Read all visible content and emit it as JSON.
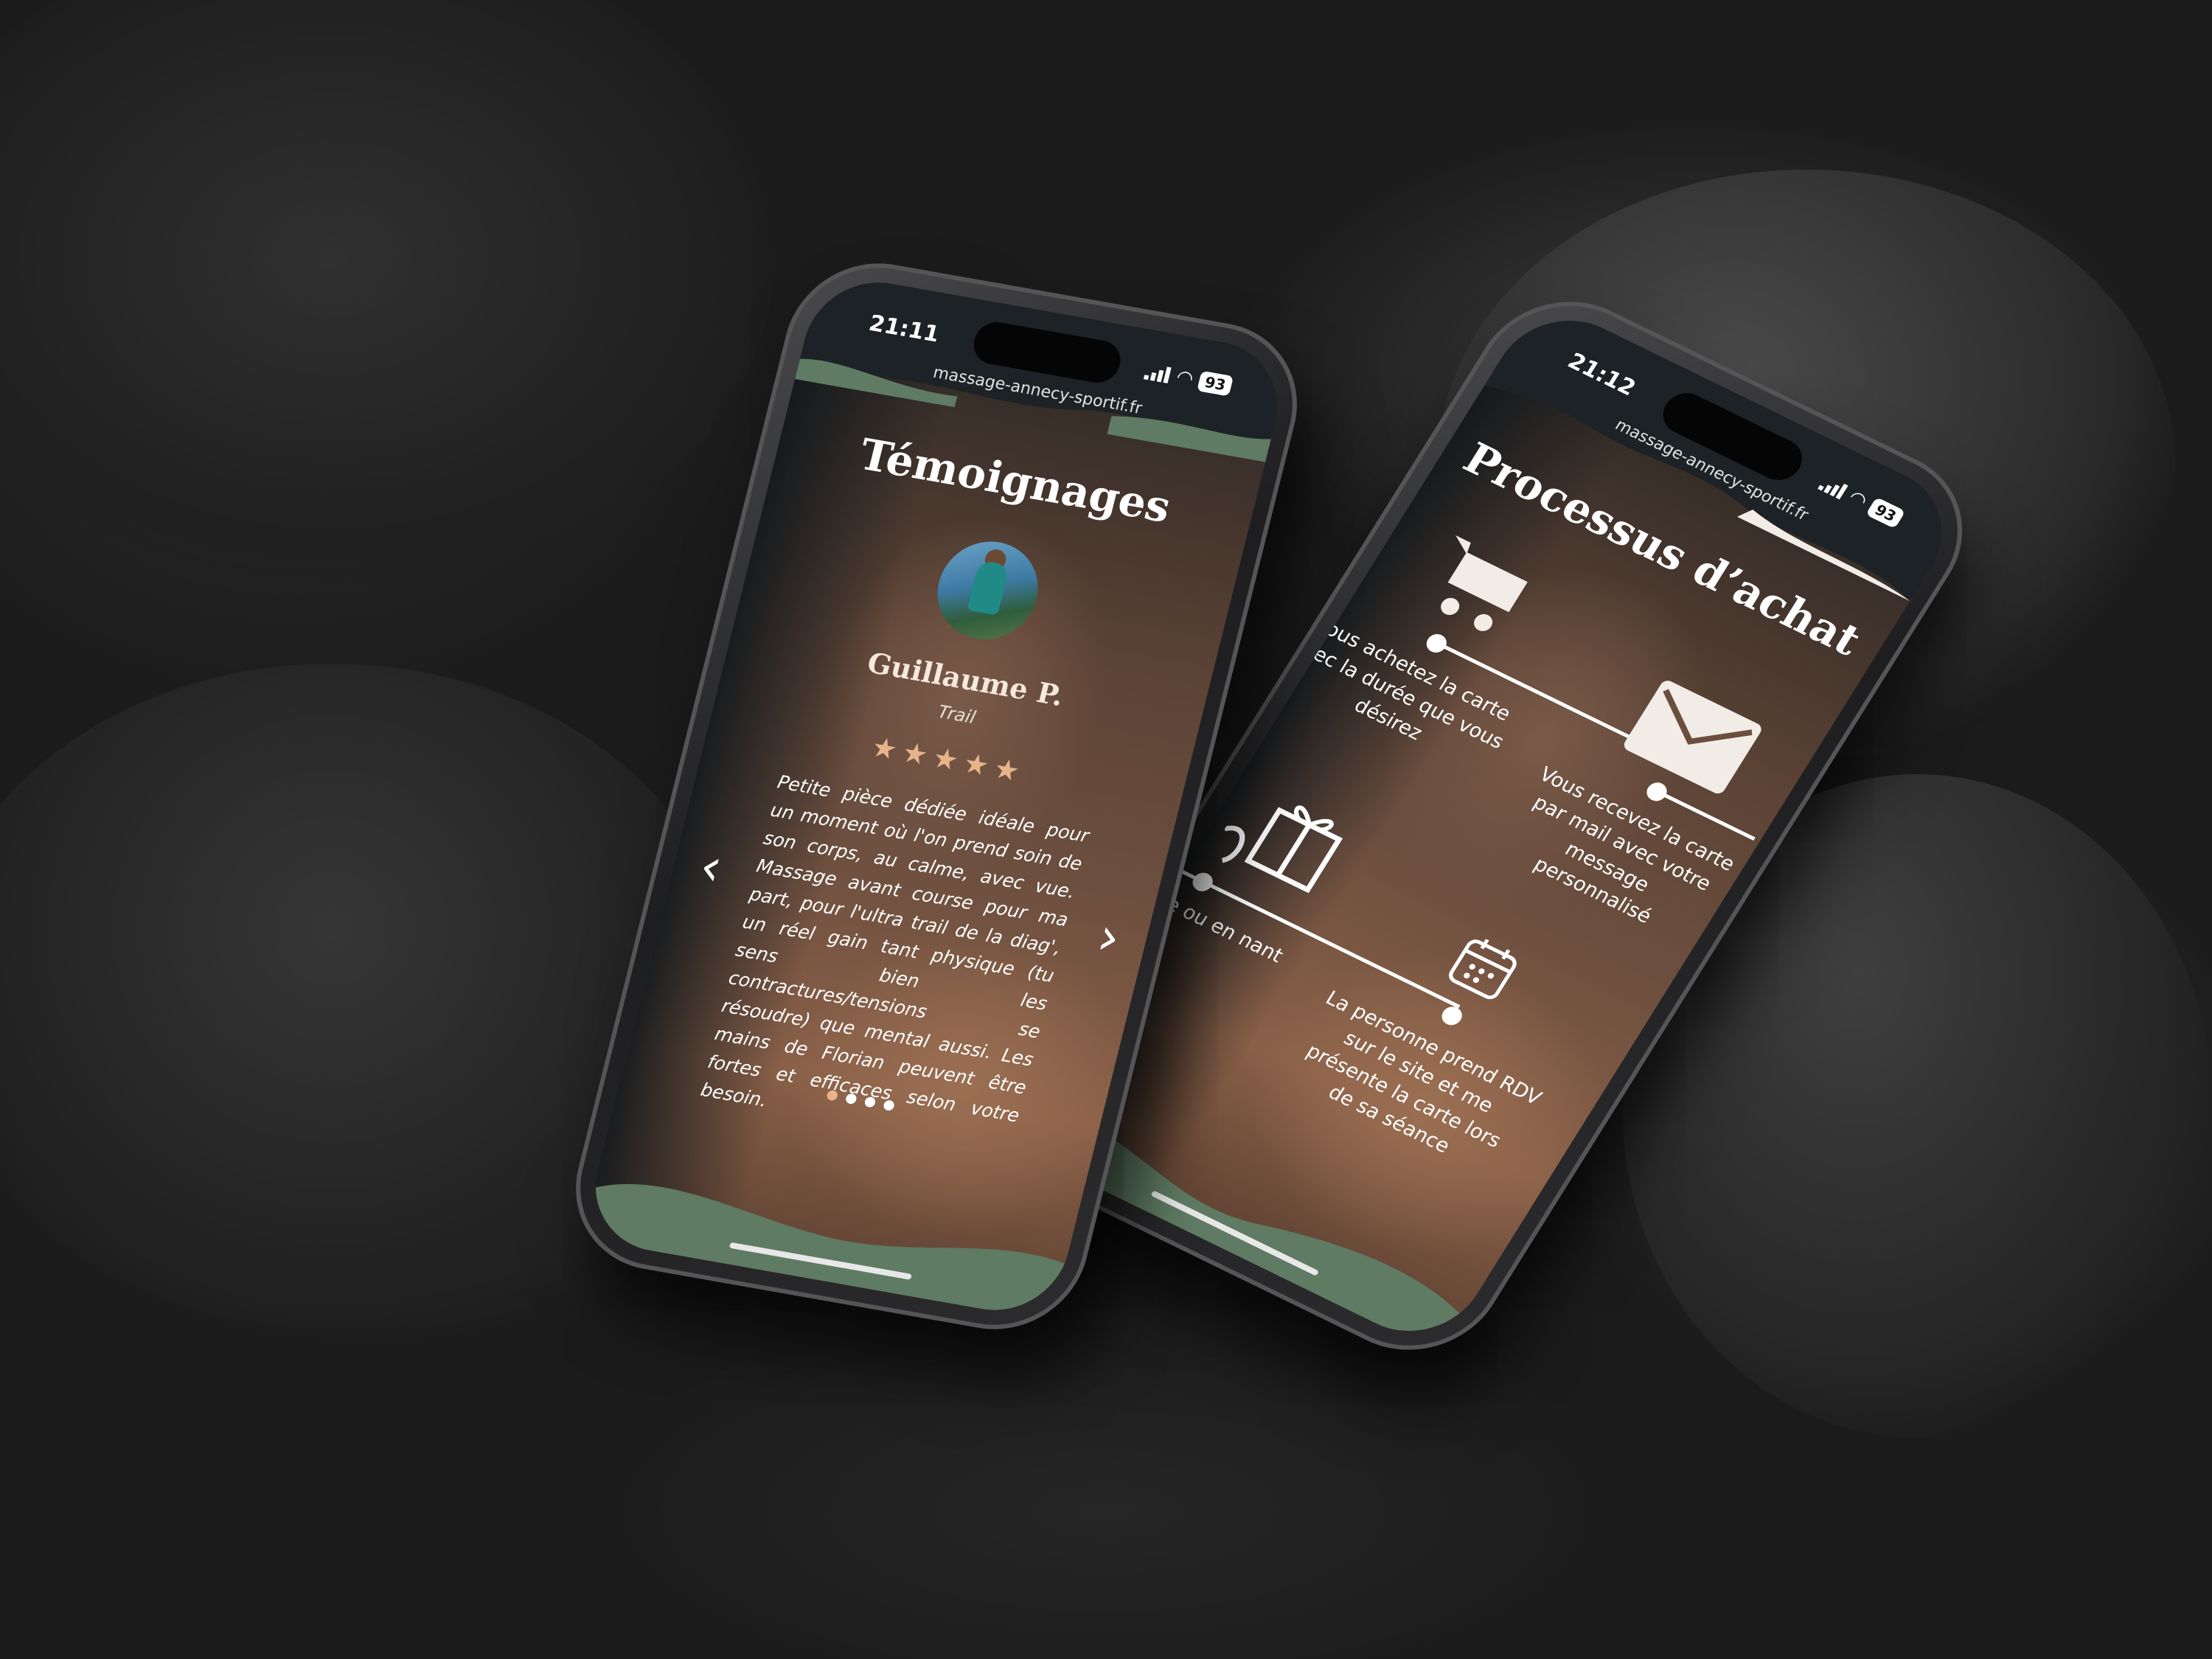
{
  "phone_left": {
    "status": {
      "time": "21:11",
      "battery": "93"
    },
    "url": "massage-annecy-sportif.fr",
    "title": "Témoignages",
    "testimonial": {
      "name": "Guillaume P.",
      "sport": "Trail",
      "rating": 5,
      "rating_max": 5,
      "text": "Petite pièce dédiée idéale pour un moment où l'on prend soin de son corps, au calme, avec vue. Massage avant course pour ma part, pour l'ultra trail de la diag', un réel gain tant physique (tu sens bien les contractures/tensions se résoudre) que mental aussi. Les mains de Florian peuvent être fortes et efficaces selon votre besoin."
    },
    "carousel": {
      "prev_arrow": "‹",
      "next_arrow": "›",
      "slides": 4,
      "active_slide": 1
    }
  },
  "phone_right": {
    "status": {
      "time": "21:12",
      "battery": "93"
    },
    "url": "massage-annecy-sportif.fr",
    "title": "Processus d’achat",
    "steps": [
      {
        "icon": "cart-icon",
        "text": "ous achetez la carte vec la durée que vous désirez"
      },
      {
        "icon": "envelope-icon",
        "text": "Vous recevez la carte par mail avec votre message personnalisé"
      },
      {
        "icon": "gift-icon",
        "text": "ez la carte ou en nant"
      },
      {
        "icon": "calendar-icon",
        "text": "La personne prend RDV sur le site et me présente la carte lors de sa séance"
      }
    ]
  },
  "colors": {
    "accent_green": "#5f7b63",
    "star": "#e7b48a",
    "text": "#ffffff"
  }
}
